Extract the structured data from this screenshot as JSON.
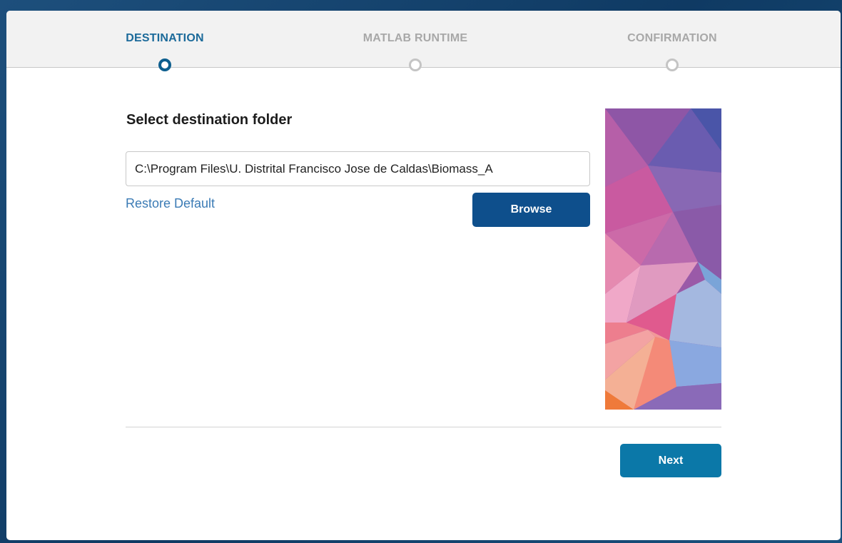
{
  "steps": [
    {
      "label": "DESTINATION",
      "state": "active"
    },
    {
      "label": "MATLAB RUNTIME",
      "state": "inactive"
    },
    {
      "label": "CONFIRMATION",
      "state": "inactive"
    }
  ],
  "destination": {
    "heading": "Select destination folder",
    "path_value": "C:\\Program Files\\U. Distrital Francisco Jose de Caldas\\Biomass_A",
    "restore_label": "Restore Default",
    "browse_label": "Browse"
  },
  "footer": {
    "next_label": "Next"
  },
  "colors": {
    "active_step": "#1b6a9a",
    "inactive_step": "#a8a8a8",
    "browse_button": "#0e4f8c",
    "next_button": "#0b78a8",
    "link": "#3b7bb5"
  }
}
